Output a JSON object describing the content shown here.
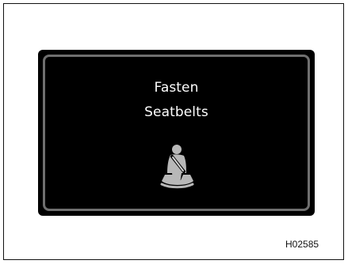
{
  "warning_screen": {
    "line1": "Fasten",
    "line2": "Seatbelts",
    "icon": "seatbelt-icon"
  },
  "figure_code": "H02585",
  "colors": {
    "screen_bg": "#000000",
    "bezel": "#6f6f6f",
    "text": "#ffffff",
    "icon": "#b8b8b8",
    "page_bg": "#ffffff"
  }
}
